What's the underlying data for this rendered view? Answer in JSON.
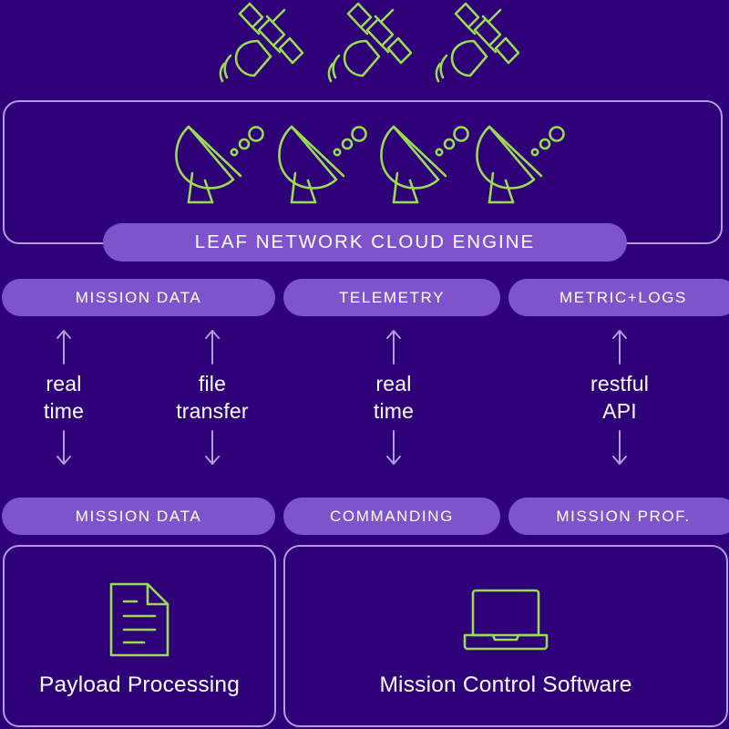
{
  "theme": {
    "background": "#2e0179",
    "pill_fill": "#7f54cb",
    "border_stroke": "#b49ae0",
    "icon_green": "#9bdb52",
    "text_white": "#ffffff"
  },
  "space_segment": {
    "icons": [
      {
        "name": "satellite-icon-1"
      },
      {
        "name": "satellite-icon-2"
      },
      {
        "name": "satellite-icon-3"
      }
    ]
  },
  "ground_segment": {
    "panel_name": "ground-station-panel",
    "icons": [
      {
        "name": "dish-antenna-icon-1"
      },
      {
        "name": "dish-antenna-icon-2"
      },
      {
        "name": "dish-antenna-icon-3"
      },
      {
        "name": "dish-antenna-icon-4"
      }
    ]
  },
  "cloud_engine": {
    "label": "LEAF NETWORK CLOUD ENGINE"
  },
  "service_pills_top": [
    {
      "label": "MISSION DATA"
    },
    {
      "label": "TELEMETRY"
    },
    {
      "label": "METRIC+LOGS"
    }
  ],
  "flows": [
    {
      "label": "real\ntime"
    },
    {
      "label": "file\ntransfer"
    },
    {
      "label": "real\ntime"
    },
    {
      "label": "restful\nAPI"
    }
  ],
  "service_pills_bottom": [
    {
      "label": "MISSION DATA"
    },
    {
      "label": "COMMANDING"
    },
    {
      "label": "MISSION PROF."
    }
  ],
  "cards": [
    {
      "label": "Payload Processing",
      "icon": "document-icon"
    },
    {
      "label": "Mission Control Software",
      "icon": "laptop-icon"
    }
  ]
}
